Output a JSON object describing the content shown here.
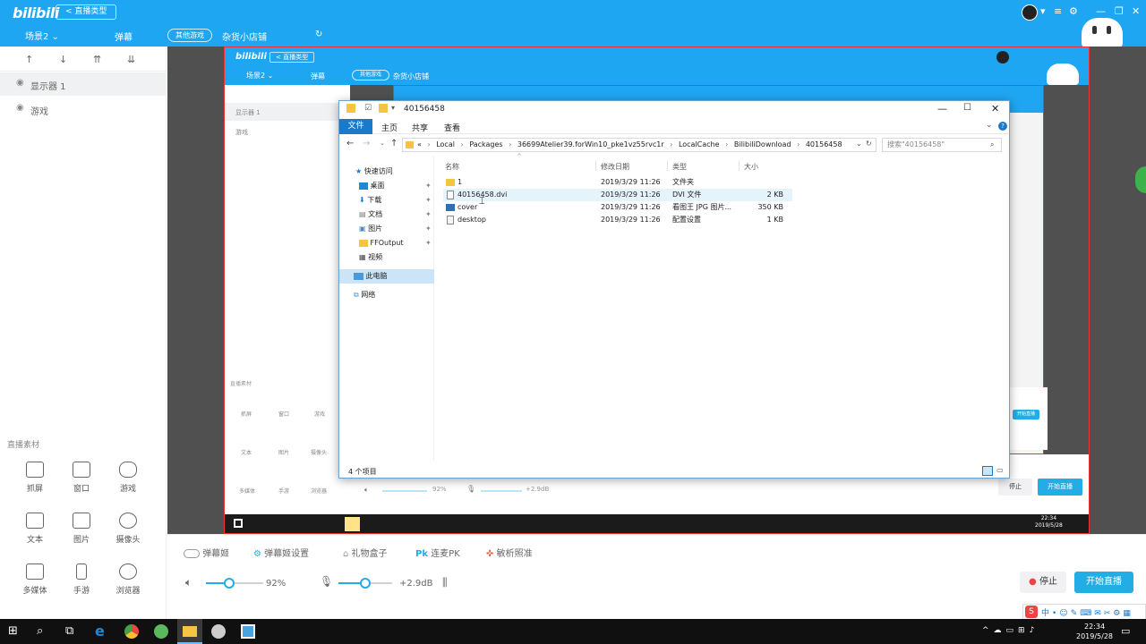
{
  "app": {
    "logo": "bilibili",
    "back_label": "< 直播类型",
    "scene_label": "场景2 ⌄",
    "danmu_tab": "弹幕",
    "category": "其他游戏",
    "room_name": "杂货小店铺"
  },
  "sidebar": {
    "sources": [
      "显示器 1",
      "游戏"
    ],
    "materials_title": "直播素材",
    "materials": [
      "抓屏",
      "窗口",
      "游戏",
      "文本",
      "图片",
      "摄像头",
      "多媒体",
      "手游",
      "浏览器"
    ]
  },
  "explorer": {
    "title": "40156458",
    "ribbon": [
      "文件",
      "主页",
      "共享",
      "查看"
    ],
    "breadcrumb": [
      "«",
      "Local",
      "Packages",
      "36699Atelier39.forWin10_pke1vz55rvc1r",
      "LocalCache",
      "BilibiliDownload",
      "40156458"
    ],
    "search_placeholder": "搜索\"40156458\"",
    "nav": [
      "快速访问",
      "桌面",
      "下载",
      "文档",
      "图片",
      "FFOutput",
      "视频",
      "此电脑",
      "网络"
    ],
    "columns": [
      "名称",
      "修改日期",
      "类型",
      "大小"
    ],
    "files": [
      {
        "name": "1",
        "date": "2019/3/29 11:26",
        "type": "文件夹",
        "size": ""
      },
      {
        "name": "40156458.dvi",
        "date": "2019/3/29 11:26",
        "type": "DVI 文件",
        "size": "2 KB"
      },
      {
        "name": "cover",
        "date": "2019/3/29 11:26",
        "type": "看图王 JPG 图片...",
        "size": "350 KB"
      },
      {
        "name": "desktop",
        "date": "2019/3/29 11:26",
        "type": "配置设置",
        "size": "1 KB"
      }
    ],
    "status": "4 个项目"
  },
  "bottom": {
    "functions": [
      "弹幕姬",
      "弹幕姬设置",
      "礼物盒子",
      "连麦PK",
      "敏析照准"
    ],
    "volume": "92%",
    "volume_level": 0.4,
    "mic": "+2.9dB",
    "mic_level": 0.5,
    "stop_label": "停止",
    "live_label": "开始直播"
  },
  "inner_capture": {
    "back_label": "< 直播类型",
    "scene_label": "场景2 ⌄",
    "danmu_tab": "弹幕",
    "category": "其他游戏",
    "room_name": "杂货小店铺",
    "sources": [
      "显示器 1",
      "游戏"
    ],
    "materials_title": "直播素材",
    "materials": [
      "抓屏",
      "窗口",
      "游戏",
      "文本",
      "图片",
      "摄像头",
      "多媒体",
      "手游",
      "浏览器"
    ],
    "volume": "92%",
    "mic": "+2.9dB",
    "stop_label": "停止",
    "live_label": "开始直播",
    "clock_time": "22:34",
    "clock_date": "2019/5/28"
  },
  "clock": {
    "time": "22:34",
    "date": "2019/5/28"
  },
  "colors": {
    "brand_blue": "#1fa6f2",
    "accent_blue": "#23ade5",
    "ribbon_file": "#1979ca"
  }
}
